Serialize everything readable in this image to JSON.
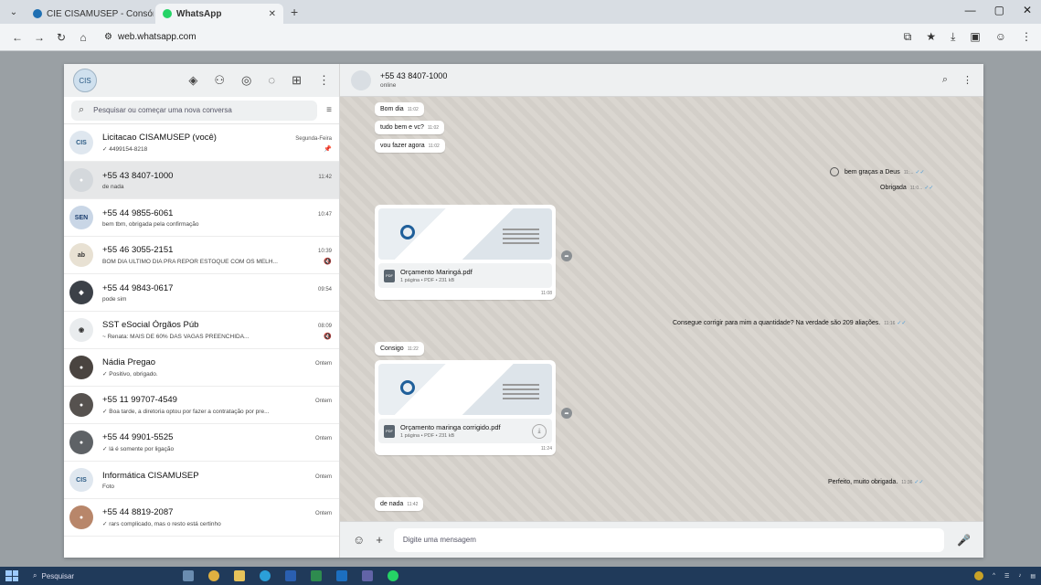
{
  "browser": {
    "tabs": [
      {
        "title": "CIE CISAMUSEP - Consórcio Públ",
        "active": false,
        "color": "#1f6fb2"
      },
      {
        "title": "WhatsApp",
        "active": true,
        "color": "#25d366"
      }
    ],
    "url": "web.whatsapp.com"
  },
  "sidebar": {
    "search_placeholder": "Pesquisar ou começar uma nova conversa",
    "chats": [
      {
        "name": "Licitacao CISAMUSEP (você)",
        "time": "Segunda-Feira",
        "preview": "✓ 4499154-8218",
        "pinned": true,
        "avatar_color": "#dfe7ef"
      },
      {
        "name": "+55 43 8407-1000",
        "time": "11:42",
        "preview": "de nada",
        "pinned": false,
        "active": true,
        "avatar_color": "#d4d8dc"
      },
      {
        "name": "+55 44 9855-6061",
        "time": "10:47",
        "preview": "bem tbm, obrigada pela confirmação",
        "pinned": false,
        "avatar_color": "#c9d6e6"
      },
      {
        "name": "+55 46 3055-2151",
        "time": "10:39",
        "preview": "BOM DIA ULTIMO DIA PRA REPOR ESTOQUE COM OS MELH...",
        "pinned": false,
        "avatar_color": "#e8e1d3"
      },
      {
        "name": "+55 44 9843-0617",
        "time": "09:54",
        "preview": "pode sim",
        "pinned": false,
        "avatar_color": "#3c4148"
      },
      {
        "name": "SST eSocial Órgãos Púb",
        "time": "08:09",
        "preview": "~ Renata: MAIS DE 60% DAS VAGAS PREENCHIDA...",
        "pinned": false,
        "avatar_color": "#e9ecee"
      },
      {
        "name": "Nádia Pregao",
        "time": "Ontem",
        "preview": "✓ Positivo, obrigado.",
        "pinned": false,
        "avatar_color": "#4a4440"
      },
      {
        "name": "+55 11 99707-4549",
        "time": "Ontem",
        "preview": "✓ Boa tarde, a diretoria optou por fazer a contratação por pre...",
        "pinned": false,
        "avatar_color": "#56524f"
      },
      {
        "name": "+55 44 9901-5525",
        "time": "Ontem",
        "preview": "✓ lá é somente por ligação",
        "pinned": false,
        "avatar_color": "#5e6266"
      },
      {
        "name": "Informática CISAMUSEP",
        "time": "Ontem",
        "preview": "Foto",
        "pinned": false,
        "avatar_color": "#dfe7ef"
      },
      {
        "name": "+55 44 8819-2087",
        "time": "Ontem",
        "preview": "✓ rars complicado, mas o resto está certinho",
        "pinned": false,
        "avatar_color": "#b8866a"
      }
    ]
  },
  "chat": {
    "title": "+55 43 8407-1000",
    "status": "online",
    "composer_placeholder": "Digite uma mensagem",
    "messages": {
      "m1": {
        "text": "Bom dia",
        "time": "11:02"
      },
      "m2": {
        "text": "tudo bem e vc?",
        "time": "11:02"
      },
      "m3": {
        "text": "vou fazer agora",
        "time": "11:02"
      },
      "m4": {
        "text": "bem graças a Deus",
        "time": "11:..."
      },
      "m5": {
        "text": "Obrigada",
        "time": "11:0..."
      },
      "doc1": {
        "name": "Orçamento Maringá.pdf",
        "meta": "1 página • PDF • 231 kB",
        "time": "11:08"
      },
      "m6": {
        "text": "Consegue corrigir para mim a quantidade? Na verdade são 209 aliações.",
        "time": "11:16"
      },
      "m7": {
        "text": "Consigo",
        "time": "11:22"
      },
      "doc2": {
        "name": "Orçamento maringa corrigido.pdf",
        "meta": "1 página • PDF • 231 kB",
        "time": "11:24"
      },
      "m8": {
        "text": "Perfeito, muito obrigada.",
        "time": "11:36"
      },
      "m9": {
        "text": "de nada",
        "time": "11:42"
      }
    }
  },
  "taskbar": {
    "search_label": "Pesquisar"
  }
}
